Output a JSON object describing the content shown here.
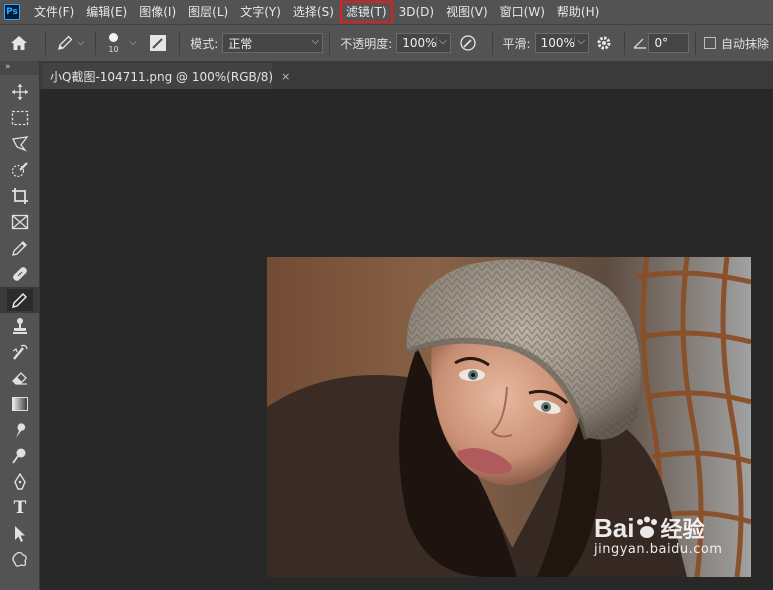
{
  "app": {
    "logo_text": "Ps"
  },
  "menu": {
    "items": [
      "文件(F)",
      "编辑(E)",
      "图像(I)",
      "图层(L)",
      "文字(Y)",
      "选择(S)",
      "滤镜(T)",
      "3D(D)",
      "视图(V)",
      "窗口(W)",
      "帮助(H)"
    ],
    "highlighted_index": 6,
    "highlight_color": "#e51c1c"
  },
  "options": {
    "brush_size": "10",
    "mode_label": "模式:",
    "mode_value": "正常",
    "opacity_label": "不透明度:",
    "opacity_value": "100%",
    "smoothing_label": "平滑:",
    "smoothing_value": "100%",
    "angle_value": "0°",
    "auto_erase_label": "自动抹除"
  },
  "document": {
    "tab_title": "小Q截图-104711.png @ 100%(RGB/8)",
    "close_glyph": "×"
  },
  "toolbar": {
    "collapse_glyph": "»",
    "tools": [
      "move-tool",
      "marquee-tool",
      "lasso-tool",
      "quick-select-tool",
      "crop-tool",
      "frame-tool",
      "eyedropper-tool",
      "healing-brush-tool",
      "pencil-tool",
      "clone-stamp-tool",
      "history-brush-tool",
      "eraser-tool",
      "gradient-tool",
      "smudge-tool",
      "dodge-tool",
      "pen-tool",
      "type-tool",
      "path-select-tool",
      "shape-tool"
    ],
    "active_index": 8,
    "type_glyph": "T"
  },
  "watermark": {
    "brand_left": "Bai",
    "brand_right": "经验",
    "url": "jingyan.baidu.com"
  },
  "colors": {
    "ui_panel": "#535353",
    "canvas_bg": "#282828",
    "accent": "#31a8ff"
  }
}
